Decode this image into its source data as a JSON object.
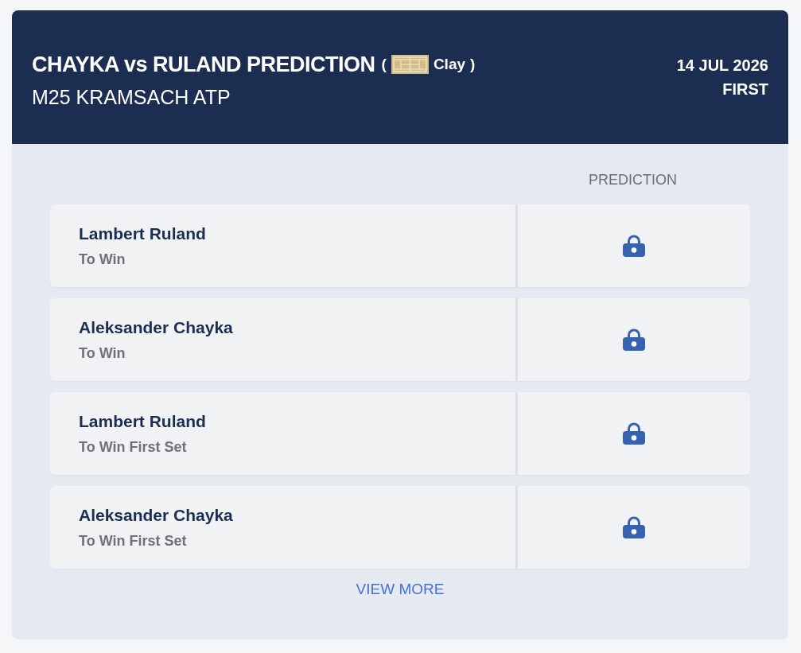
{
  "header": {
    "title": "CHAYKA vs RULAND PREDICTION",
    "surface": {
      "open": "(",
      "label": "Clay",
      "close": ")"
    },
    "tournament": "M25 KRAMSACH ATP",
    "date": "14 JUL 2026",
    "round": "FIRST"
  },
  "table": {
    "column_header": "PREDICTION",
    "rows": [
      {
        "player": "Lambert Ruland",
        "market": "To Win",
        "locked": true
      },
      {
        "player": "Aleksander Chayka",
        "market": "To Win",
        "locked": true
      },
      {
        "player": "Lambert Ruland",
        "market": "To Win First Set",
        "locked": true
      },
      {
        "player": "Aleksander Chayka",
        "market": "To Win First Set",
        "locked": true
      }
    ]
  },
  "view_more": "VIEW MORE"
}
